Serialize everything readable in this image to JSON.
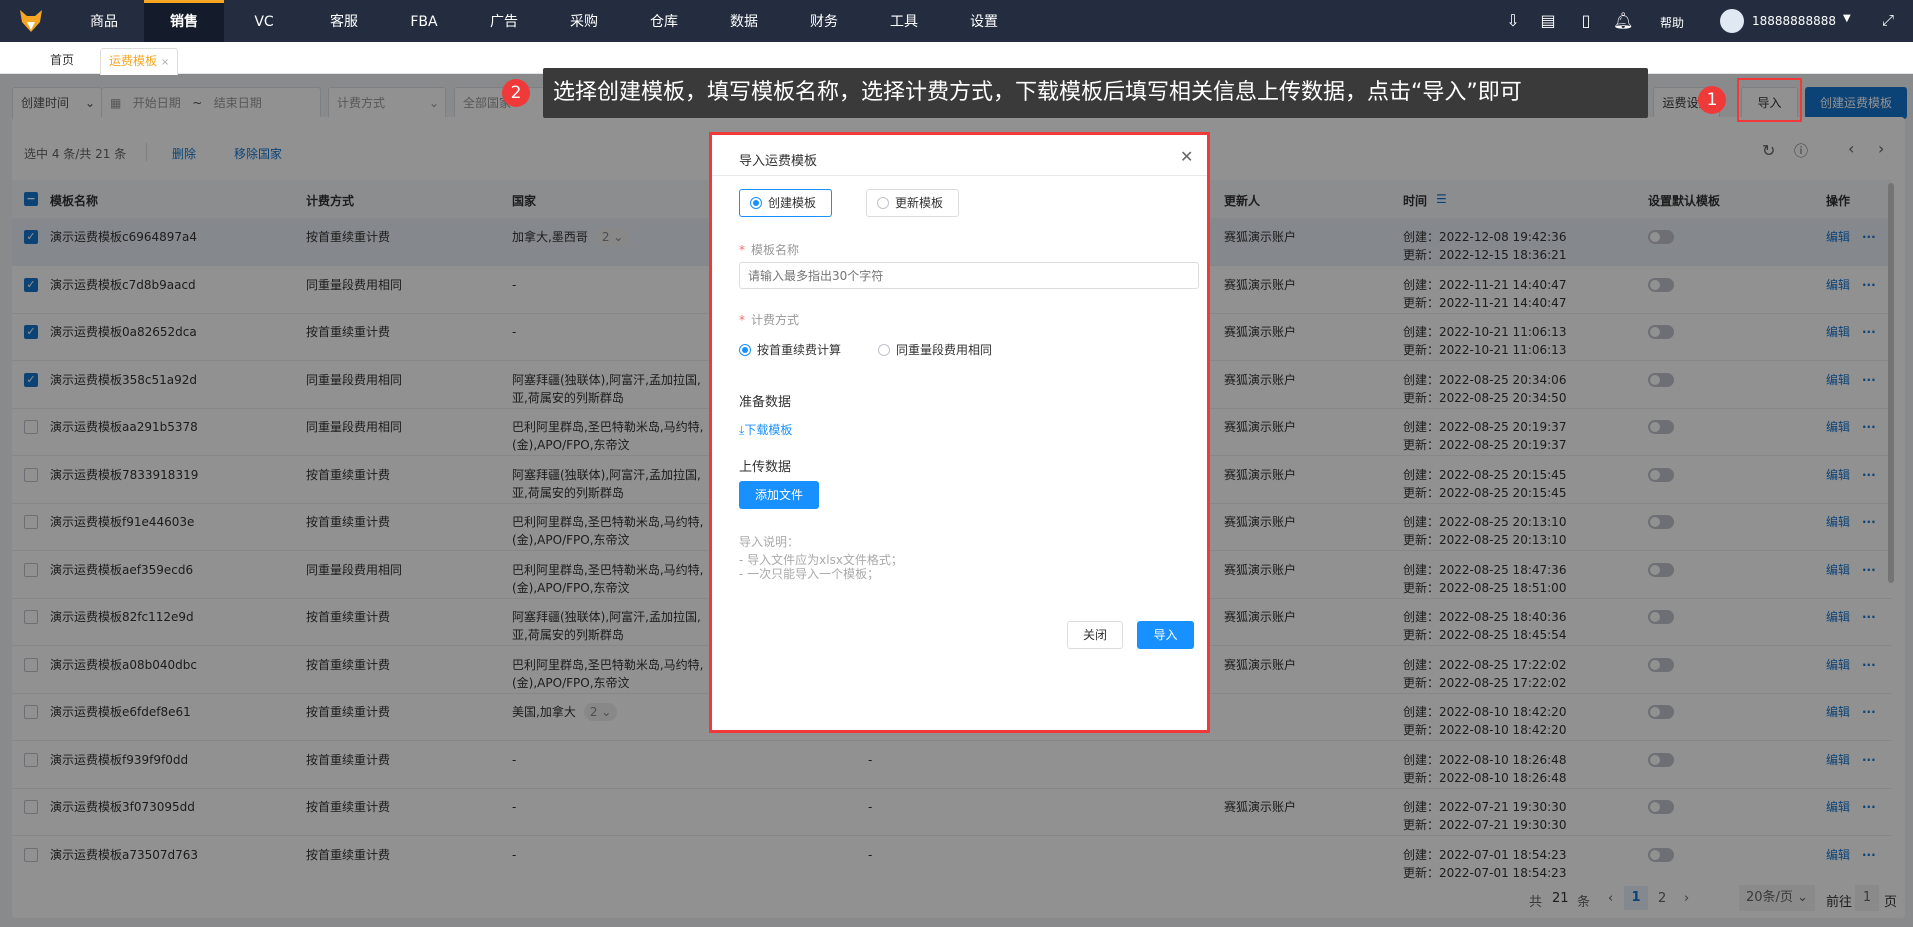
{
  "nav": {
    "items": [
      "商品",
      "销售",
      "VC",
      "客服",
      "FBA",
      "广告",
      "采购",
      "仓库",
      "数据",
      "财务",
      "工具",
      "设置"
    ],
    "active": 1,
    "help": "帮助",
    "user": "18888888888"
  },
  "tabs": {
    "home": "首页",
    "current": "运费模板",
    "close": "×"
  },
  "filters": {
    "time_type": "创建时间",
    "start": "开始日期",
    "sep": "~",
    "end": "结束日期",
    "method": "计费方式",
    "country": "全部国家"
  },
  "actions": {
    "settings": "运费设置",
    "import": "导入",
    "create": "创建运费模板"
  },
  "toolbar": {
    "selected": "选中 4 条/共 21 条",
    "delete": "删除",
    "remove_country": "移除国家"
  },
  "columns": [
    "模板名称",
    "计费方式",
    "国家",
    "更新人",
    "时间",
    "设置默认模板",
    "操作"
  ],
  "rows": [
    {
      "name": "演示运费模板c6964897a4",
      "method": "按首重续重计费",
      "c1": "加拿大,墨西哥",
      "more": "2",
      "col": "",
      "user": "赛狐演示账户",
      "created": "创建：2022-12-08 19:42:36",
      "updated": "更新：2022-12-15 18:36:21",
      "checked": true
    },
    {
      "name": "演示运费模板c7d8b9aacd",
      "method": "同重量段费用相同",
      "c1": "-",
      "col": "",
      "user": "赛狐演示账户",
      "created": "创建：2022-11-21 14:40:47",
      "updated": "更新：2022-11-21 14:40:47",
      "checked": true
    },
    {
      "name": "演示运费模板0a82652dca",
      "method": "按首重续重计费",
      "c1": "-",
      "col": "",
      "user": "赛狐演示账户",
      "created": "创建：2022-10-21 11:06:13",
      "updated": "更新：2022-10-21 11:06:13",
      "checked": true
    },
    {
      "name": "演示运费模板358c51a92d",
      "method": "同重量段费用相同",
      "c1": "阿塞拜疆(独联体),阿富汗,孟加拉国,",
      "c2": "亚,荷属安的列斯群岛",
      "col": "",
      "user": "赛狐演示账户",
      "created": "创建：2022-08-25 20:34:06",
      "updated": "更新：2022-08-25 20:34:50",
      "checked": true
    },
    {
      "name": "演示运费模板aa291b5378",
      "method": "同重量段费用相同",
      "c1": "巴利阿里群岛,圣巴特勒米岛,马约特,",
      "c2": "(金),APO/FPO,东帝汶",
      "col": "",
      "user": "赛狐演示账户",
      "created": "创建：2022-08-25 20:19:37",
      "updated": "更新：2022-08-25 20:19:37",
      "checked": false
    },
    {
      "name": "演示运费模板7833918319",
      "method": "按首重续重计费",
      "c1": "阿塞拜疆(独联体),阿富汗,孟加拉国,",
      "c2": "亚,荷属安的列斯群岛",
      "col": "",
      "user": "赛狐演示账户",
      "created": "创建：2022-08-25 20:15:45",
      "updated": "更新：2022-08-25 20:15:45",
      "checked": false
    },
    {
      "name": "演示运费模板f91e44603e",
      "method": "按首重续重计费",
      "c1": "巴利阿里群岛,圣巴特勒米岛,马约特,",
      "c2": "(金),APO/FPO,东帝汶",
      "col": "",
      "user": "赛狐演示账户",
      "created": "创建：2022-08-25 20:13:10",
      "updated": "更新：2022-08-25 20:13:10",
      "checked": false
    },
    {
      "name": "演示运费模板aef359ecd6",
      "method": "同重量段费用相同",
      "c1": "巴利阿里群岛,圣巴特勒米岛,马约特,",
      "c2": "(金),APO/FPO,东帝汶",
      "col": "",
      "user": "赛狐演示账户",
      "created": "创建：2022-08-25 18:47:36",
      "updated": "更新：2022-08-25 18:51:00",
      "checked": false
    },
    {
      "name": "演示运费模板82fc112e9d",
      "method": "按首重续重计费",
      "c1": "阿塞拜疆(独联体),阿富汗,孟加拉国,",
      "c2": "亚,荷属安的列斯群岛",
      "col": "",
      "user": "赛狐演示账户",
      "created": "创建：2022-08-25 18:40:36",
      "updated": "更新：2022-08-25 18:45:54",
      "checked": false
    },
    {
      "name": "演示运费模板a08b040dbc",
      "method": "按首重续重计费",
      "c1": "巴利阿里群岛,圣巴特勒米岛,马约特,",
      "c2": "(金),APO/FPO,东帝汶",
      "col": "",
      "user": "赛狐演示账户",
      "created": "创建：2022-08-25 17:22:02",
      "updated": "更新：2022-08-25 17:22:02",
      "checked": false
    },
    {
      "name": "演示运费模板e6fdef8e61",
      "method": "按首重续重计费",
      "c1": "美国,加拿大",
      "more": "2",
      "col": "",
      "user": "",
      "created": "创建：2022-08-10 18:42:20",
      "updated": "更新：2022-08-10 18:42:20",
      "checked": false
    },
    {
      "name": "演示运费模板f939f9f0dd",
      "method": "按首重续重计费",
      "c1": "-",
      "col": "-",
      "user": "",
      "created": "创建：2022-08-10 18:26:48",
      "updated": "更新：2022-08-10 18:26:48",
      "checked": false
    },
    {
      "name": "演示运费模板3f073095dd",
      "method": "按首重续重计费",
      "c1": "-",
      "col": "-",
      "user": "赛狐演示账户",
      "created": "创建：2022-07-21 19:30:30",
      "updated": "更新：2022-07-21 19:30:30",
      "checked": false
    },
    {
      "name": "演示运费模板a73507d763",
      "method": "按首重续重计费",
      "c1": "-",
      "col": "-",
      "user": "",
      "created": "创建：2022-07-01 18:54:23",
      "updated": "更新：2022-07-01 18:54:23",
      "checked": false
    }
  ],
  "row_actions": {
    "edit": "编辑",
    "more": "···"
  },
  "pagination": {
    "total_prefix": "共",
    "total": "21",
    "total_suffix": "条",
    "pages": [
      "1",
      "2"
    ],
    "current": "1",
    "page_size": "20条/页",
    "goto": "前往",
    "goto_value": "1",
    "goto_suffix": "页"
  },
  "tooltip": {
    "step": "2",
    "text": "选择创建模板，填写模板名称，选择计费方式，下载模板后填写相关信息上传数据，点击“导入”即可"
  },
  "step1": "1",
  "modal": {
    "title": "导入运费模板",
    "mode_create": "创建模板",
    "mode_update": "更新模板",
    "name_label": "模板名称",
    "name_placeholder": "请输入最多指出30个字符",
    "method_label": "计费方式",
    "method_a": "按首重续费计算",
    "method_b": "同重量段费用相同",
    "prepare": "准备数据",
    "download": "下载模板",
    "upload": "上传数据",
    "add_file": "添加文件",
    "notes_title": "导入说明：",
    "notes": [
      "- 导入文件应为xlsx文件格式；",
      "- 一次只能导入一个模板；"
    ],
    "close": "关闭",
    "import": "导入"
  }
}
